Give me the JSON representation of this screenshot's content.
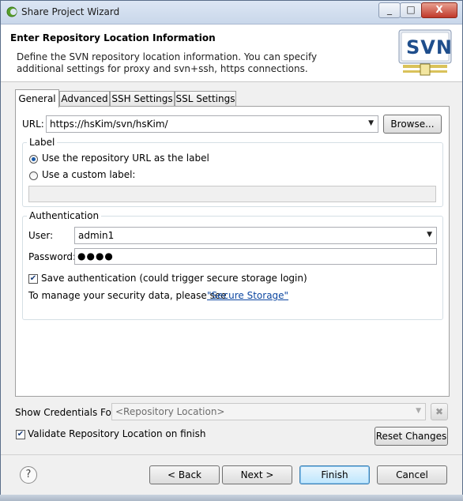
{
  "window": {
    "title": "Share Project Wizard",
    "controls": [
      "_",
      "□",
      "X"
    ]
  },
  "header": {
    "title": "Enter Repository Location Information",
    "description_line1": "Define the SVN repository location information. You can specify",
    "description_line2": "additional settings for proxy and svn+ssh, https connections.",
    "logo_text": "SVN"
  },
  "tabs": [
    {
      "label": "General",
      "active": true
    },
    {
      "label": "Advanced",
      "active": false
    },
    {
      "label": "SSH Settings",
      "active": false
    },
    {
      "label": "SSL Settings",
      "active": false
    }
  ],
  "general": {
    "url_label": "URL:",
    "url_value": "https://hsKim/svn/hsKim/",
    "browse_button": "Browse...",
    "label_group": {
      "title": "Label",
      "option_repo_url": "Use the repository URL as the label",
      "option_custom": "Use a custom label:",
      "selected": "repo_url",
      "custom_value": ""
    },
    "auth_group": {
      "title": "Authentication",
      "user_label": "User:",
      "user_value": "admin1",
      "password_label": "Password:",
      "password_value": "●●●●",
      "save_auth_label": "Save authentication (could trigger secure storage login)",
      "save_auth_checked": true,
      "manage_text": "To manage your security data, please see",
      "secure_storage_link": "\"Secure Storage\""
    }
  },
  "footer": {
    "show_credentials_label": "Show Credentials For:",
    "credentials_placeholder": "<Repository Location>",
    "clear_icon": "✖",
    "validate_label": "Validate Repository Location on finish",
    "validate_checked": true,
    "reset_button": "Reset Changes",
    "help_icon": "?",
    "back_button": "< Back",
    "next_button": "Next >",
    "finish_button": "Finish",
    "cancel_button": "Cancel"
  },
  "colors": {
    "accent": "#3c7fb1",
    "link": "#0d47a1",
    "svn_blue": "#1f4e8c"
  }
}
